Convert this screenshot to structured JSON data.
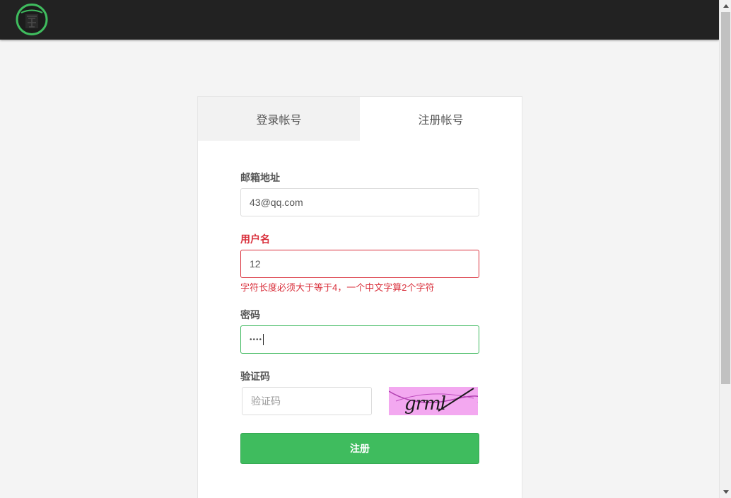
{
  "colors": {
    "topbar": "#222222",
    "accent_green": "#3fbc5e",
    "error_red": "#d9303c",
    "page_bg": "#f4f4f4"
  },
  "logo": {
    "icon": "logo-seal-icon"
  },
  "tabs": [
    {
      "label": "登录帐号",
      "active": false
    },
    {
      "label": "注册帐号",
      "active": true
    }
  ],
  "form": {
    "email": {
      "label": "邮箱地址",
      "value": "43@qq.com"
    },
    "username": {
      "label": "用户名",
      "value": "12",
      "error": "字符长度必须大于等于4，一个中文字算2个字符"
    },
    "password": {
      "label": "密码",
      "value": "••••"
    },
    "captcha": {
      "label": "验证码",
      "placeholder": "验证码",
      "image_text": "grml"
    },
    "submit_label": "注册"
  }
}
